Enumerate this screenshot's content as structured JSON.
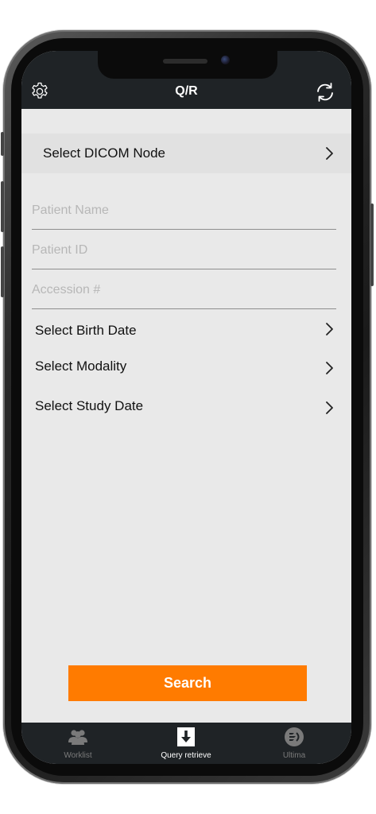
{
  "header": {
    "title": "Q/R",
    "settings_icon": "gear-icon",
    "refresh_icon": "refresh-icon"
  },
  "dicom_node": {
    "label": "Select DICOM Node",
    "icon": "chevron-right-icon"
  },
  "fields": {
    "patient_name": {
      "placeholder": "Patient Name",
      "value": ""
    },
    "patient_id": {
      "placeholder": "Patient ID",
      "value": ""
    },
    "accession": {
      "placeholder": "Accession #",
      "value": ""
    }
  },
  "selectors": [
    {
      "label": "Select Birth Date"
    },
    {
      "label": "Select Modality"
    },
    {
      "label": "Select Study Date"
    }
  ],
  "search_button": {
    "label": "Search"
  },
  "tabs": [
    {
      "label": "Worklist",
      "icon": "users-icon",
      "active": false
    },
    {
      "label": "Query retrieve",
      "icon": "download-icon",
      "active": true
    },
    {
      "label": "Ultima",
      "icon": "ultima-icon",
      "active": false
    }
  ],
  "colors": {
    "accent": "#ff7b00",
    "nav_background": "#1f2326",
    "screen_background": "#e9e9e9"
  }
}
